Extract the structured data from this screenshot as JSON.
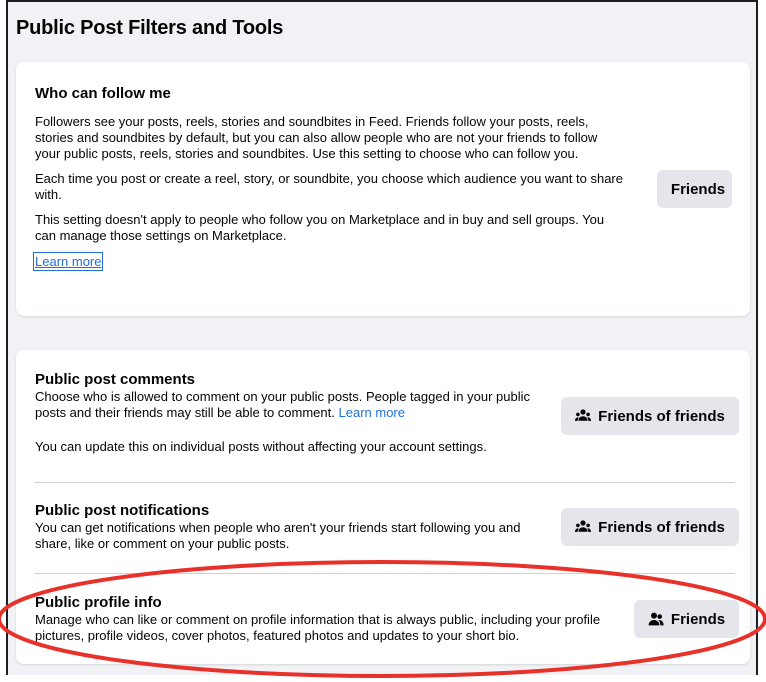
{
  "page": {
    "title": "Public Post Filters and Tools"
  },
  "follow": {
    "title": "Who can follow me",
    "paragraphs": [
      "Followers see your posts, reels, stories and soundbites in Feed. Friends follow your posts, reels, stories and soundbites by default, but you can also allow people who are not your friends to follow your public posts, reels, stories and soundbites. Use this setting to choose who can follow you.",
      "Each time you post or create a reel, story, or soundbite, you choose which audience you want to share with.",
      "This setting doesn't apply to people who follow you on Marketplace and in buy and sell groups. You can manage those settings on Marketplace."
    ],
    "learn_more": "Learn more",
    "button_label": "Friends",
    "button_icon": "friends-icon"
  },
  "comments": {
    "title": "Public post comments",
    "description": "Choose who is allowed to comment on your public posts. People tagged in your public posts and their friends may still be able to comment.",
    "learn_more": "Learn more",
    "note": "You can update this on individual posts without affecting your account settings.",
    "button_label": "Friends of friends",
    "button_icon": "friends-of-friends-icon"
  },
  "notifications": {
    "title": "Public post notifications",
    "description": "You can get notifications when people who aren't your friends start following you and share, like or comment on your public posts.",
    "button_label": "Friends of friends",
    "button_icon": "friends-of-friends-icon"
  },
  "profile_info": {
    "title": "Public profile info",
    "description": "Manage who can like or comment on profile information that is always public, including your profile pictures, profile videos, cover photos, featured photos and updates to your short bio.",
    "button_label": "Friends",
    "button_icon": "friends-icon"
  },
  "colors": {
    "link": "#216fdb",
    "button_bg": "#e4e6eb",
    "page_bg": "#f0f2f5",
    "highlight_ellipse": "#e8312a"
  }
}
